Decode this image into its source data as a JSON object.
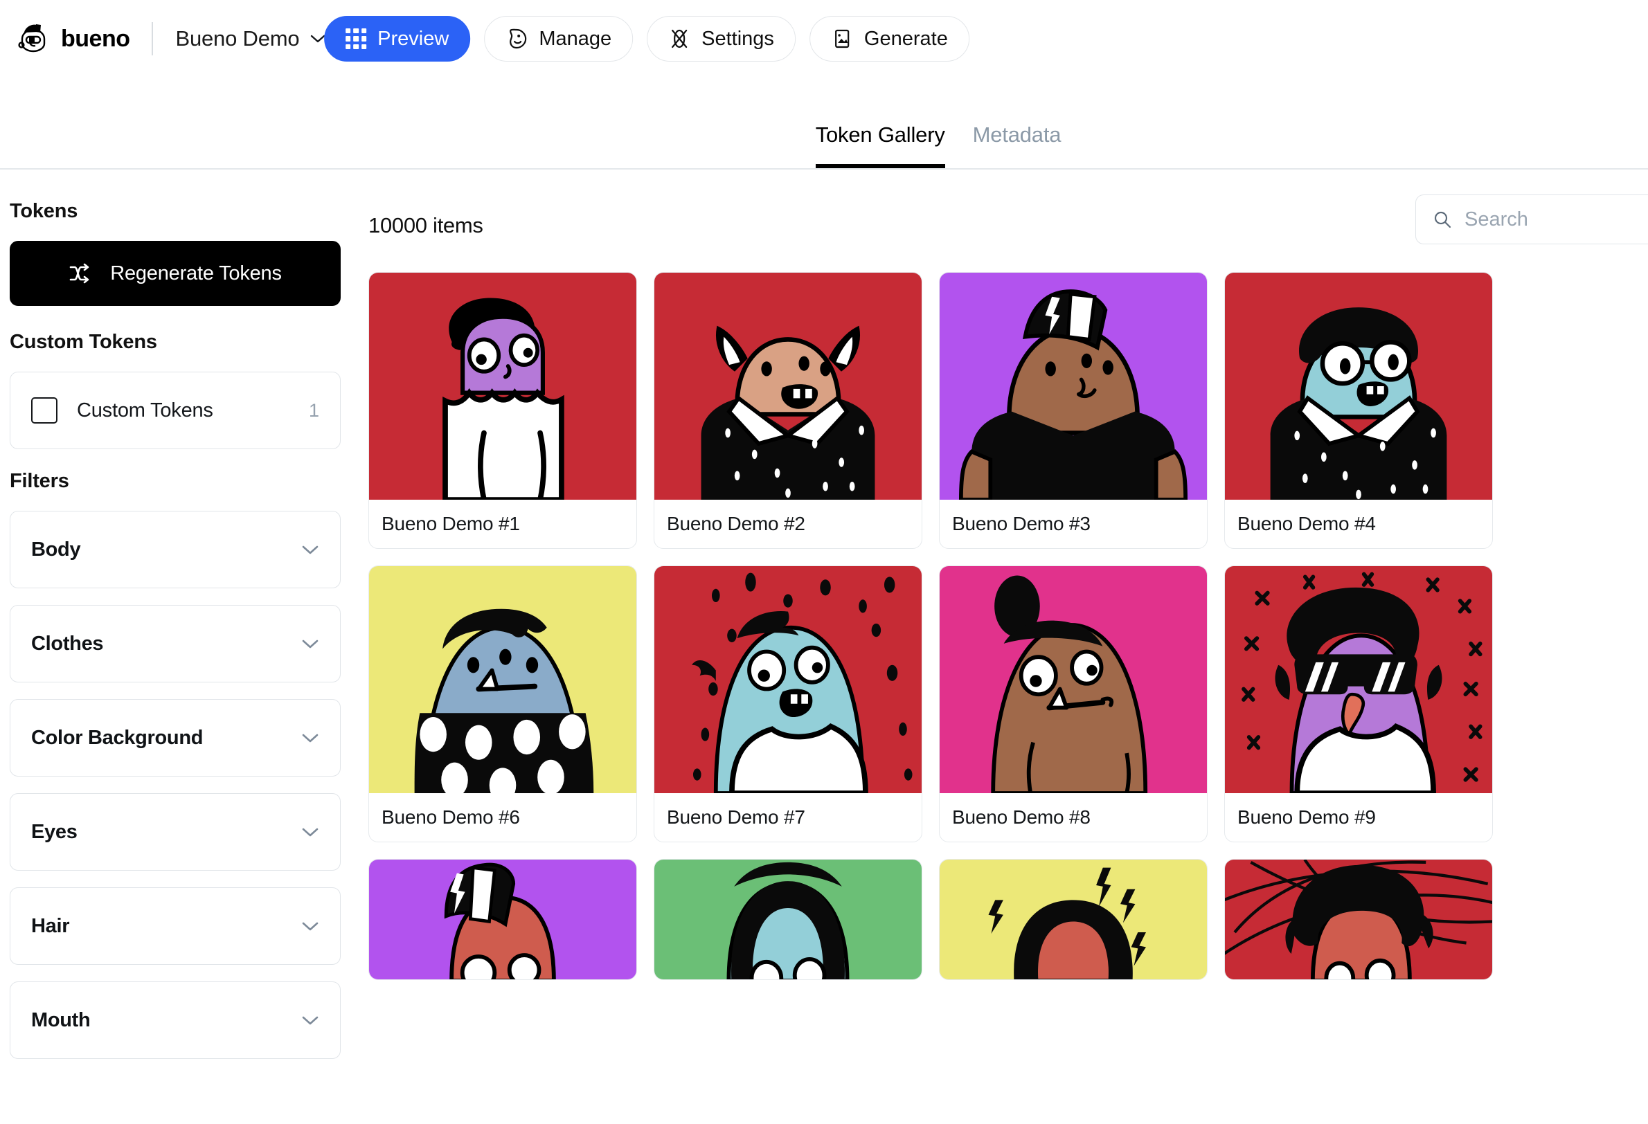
{
  "brand": {
    "name": "bueno",
    "logo_icon": "bueno-octopus-logo"
  },
  "project": {
    "name": "Bueno Demo",
    "chevron_icon": "chevron-down-icon"
  },
  "nav": [
    {
      "label": "Preview",
      "icon": "grid-dots-icon",
      "active": true
    },
    {
      "label": "Manage",
      "icon": "smiley-face-icon",
      "active": false
    },
    {
      "label": "Settings",
      "icon": "sliders-cross-icon",
      "active": false
    },
    {
      "label": "Generate",
      "icon": "image-icon",
      "active": false
    }
  ],
  "tabs": [
    {
      "label": "Token Gallery",
      "active": true
    },
    {
      "label": "Metadata",
      "active": false
    }
  ],
  "sidebar": {
    "tokens_title": "Tokens",
    "regenerate_label": "Regenerate Tokens",
    "regenerate_icon": "shuffle-icon",
    "custom_tokens_title": "Custom Tokens",
    "custom_tokens_row": {
      "label": "Custom Tokens",
      "count": "1",
      "checked": false
    },
    "filters_title": "Filters",
    "filters": [
      {
        "label": "Body"
      },
      {
        "label": "Clothes"
      },
      {
        "label": "Color Background"
      },
      {
        "label": "Eyes"
      },
      {
        "label": "Hair"
      },
      {
        "label": "Mouth"
      }
    ]
  },
  "content": {
    "items_count": "10000 items",
    "search": {
      "placeholder": "Search",
      "value": "",
      "icon": "search-icon"
    }
  },
  "colors": {
    "accent_blue": "#2b62f6",
    "red": "#c62b35",
    "purple": "#b253ee",
    "yellow": "#ece878",
    "magenta": "#e1328c",
    "green": "#6bbf76",
    "skin_tan": "#d9a184",
    "skin_brown": "#a0694a",
    "skin_purple": "#b579d8",
    "skin_blue_gray": "#8aabc9",
    "skin_light_blue": "#93cfd8",
    "skin_red": "#cf5c4e",
    "muted_text": "#8b99a7"
  },
  "tokens": [
    {
      "name": "Bueno Demo #1",
      "bg": "#c62b35",
      "skin": "#b579d8",
      "clothes": "white-scallop",
      "hair": "curly-black",
      "row": 1
    },
    {
      "name": "Bueno Demo #2",
      "bg": "#c62b35",
      "skin": "#d9a184",
      "clothes": "black-speckled-collar",
      "hair": "horns",
      "row": 1
    },
    {
      "name": "Bueno Demo #3",
      "bg": "#b253ee",
      "skin": "#a0694a",
      "clothes": "black-tshirt",
      "hair": "bolt-bandana",
      "row": 1
    },
    {
      "name": "Bueno Demo #4",
      "bg": "#c62b35",
      "skin": "#93cfd8",
      "clothes": "black-speckled-collar",
      "hair": "afro-glasses",
      "row": 1
    },
    {
      "name": "Bueno Demo #6",
      "bg": "#ece878",
      "skin": "#8aabc9",
      "clothes": "polka-dot",
      "hair": "slick-black",
      "row": 2
    },
    {
      "name": "Bueno Demo #7",
      "bg": "#c62b35",
      "skin": "#93cfd8",
      "clothes": "white-tank",
      "hair": "spiky-black",
      "row": 2
    },
    {
      "name": "Bueno Demo #8",
      "bg": "#e1328c",
      "skin": "#a0694a",
      "clothes": "none",
      "hair": "top-knot",
      "row": 2
    },
    {
      "name": "Bueno Demo #9",
      "bg": "#c62b35",
      "skin": "#b579d8",
      "clothes": "white-tank",
      "hair": "afro-sunglasses",
      "row": 2
    },
    {
      "name": "",
      "bg": "#b253ee",
      "skin": "#cf5c4e",
      "clothes": "",
      "hair": "bolt-bandana",
      "row": 3
    },
    {
      "name": "",
      "bg": "#6bbf76",
      "skin": "#93cfd8",
      "clothes": "",
      "hair": "long-black",
      "row": 3
    },
    {
      "name": "",
      "bg": "#ece878",
      "skin": "#cf5c4e",
      "clothes": "",
      "hair": "long-black-bolts",
      "row": 3
    },
    {
      "name": "",
      "bg": "#c62b35",
      "skin": "#cf5c4e",
      "clothes": "",
      "hair": "afro-scribble",
      "row": 3
    }
  ]
}
